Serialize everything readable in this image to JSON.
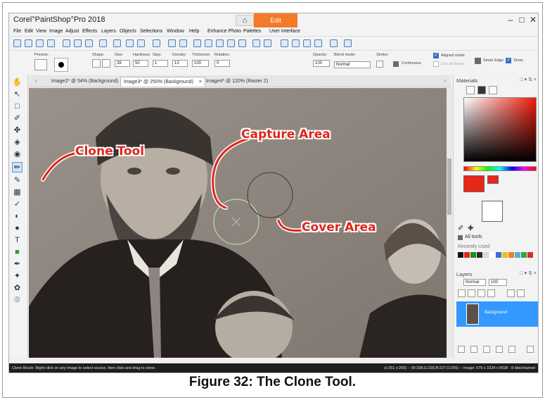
{
  "app": {
    "title": "Corel°PaintShop°Pro 2018",
    "home_icon": "home-icon",
    "edit_tab": "Edit",
    "window_controls": [
      "–",
      "□",
      "✕"
    ]
  },
  "menu": [
    "File",
    "Edit",
    "View",
    "Image",
    "Adjust",
    "Effects",
    "Layers",
    "Objects",
    "Selections",
    "Window",
    "Help",
    "Enhance Photo",
    "Palettes",
    "User Interface"
  ],
  "tool_options": {
    "presets_label": "Presets:",
    "shape_label": "Shape:",
    "size_label": "Size:",
    "size_value": "38",
    "hardness_label": "Hardness:",
    "hardness_value": "50",
    "step_label": "Step:",
    "step_value": "1",
    "density_label": "Density:",
    "density_value": "13",
    "thickness_label": "Thickness:",
    "thickness_value": "100",
    "rotation_label": "Rotation:",
    "rotation_value": "0",
    "opacity_label": "Opacity:",
    "opacity_value": "100",
    "blend_label": "Blend mode:",
    "blend_value": "Normal",
    "stroke_label": "Stroke:",
    "continuous_label": "Continuous",
    "aligned_label": "Aligned mode",
    "use_all_layers_label": "Use all layers",
    "smart_edge_label": "Smart Edge",
    "show_label": "Show"
  },
  "doc_tabs": [
    {
      "label": "Image2* @ 54% (Background)"
    },
    {
      "label": "Image3* @ 250% (Background)"
    },
    {
      "label": "Image4* @ 120% (Raster 2)"
    }
  ],
  "annotations": {
    "clone_tool": "Clone Tool",
    "capture_area": "Capture Area",
    "cover_area": "Cover Area"
  },
  "materials": {
    "title": "Materials",
    "all_tools_label": "All tools",
    "recently_used_label": "Recently Used",
    "foreground_color": "#e8261a",
    "background_color": "#ffffff",
    "recent_colors": [
      "#111111",
      "#e0261b",
      "#1a8f1a",
      "#2a2a2a",
      "#d8d8d8",
      "#ffffff",
      "#3a6fd8",
      "#e8c020",
      "#f08020",
      "#50b0e0",
      "#3aa03a",
      "#d03030"
    ]
  },
  "layers": {
    "title": "Layers",
    "blend_value": "Normal",
    "opacity_value": "100",
    "layer_name": "Background"
  },
  "status": {
    "left": "Clone Brush: Right-click on any image to select source, then click and drag to clone.",
    "right": "(x:251 y:205) -- (R:238,G:230,B:227,O:255) -- Image: 576 x 1024 x RGB - 8 bits/channel"
  },
  "caption": "Figure 32: The Clone Tool.",
  "colors": {
    "accent": "#f47a28",
    "annotation_red": "#e0261b",
    "status_bg": "#1e1e1e",
    "selection_blue": "#3399ff"
  }
}
